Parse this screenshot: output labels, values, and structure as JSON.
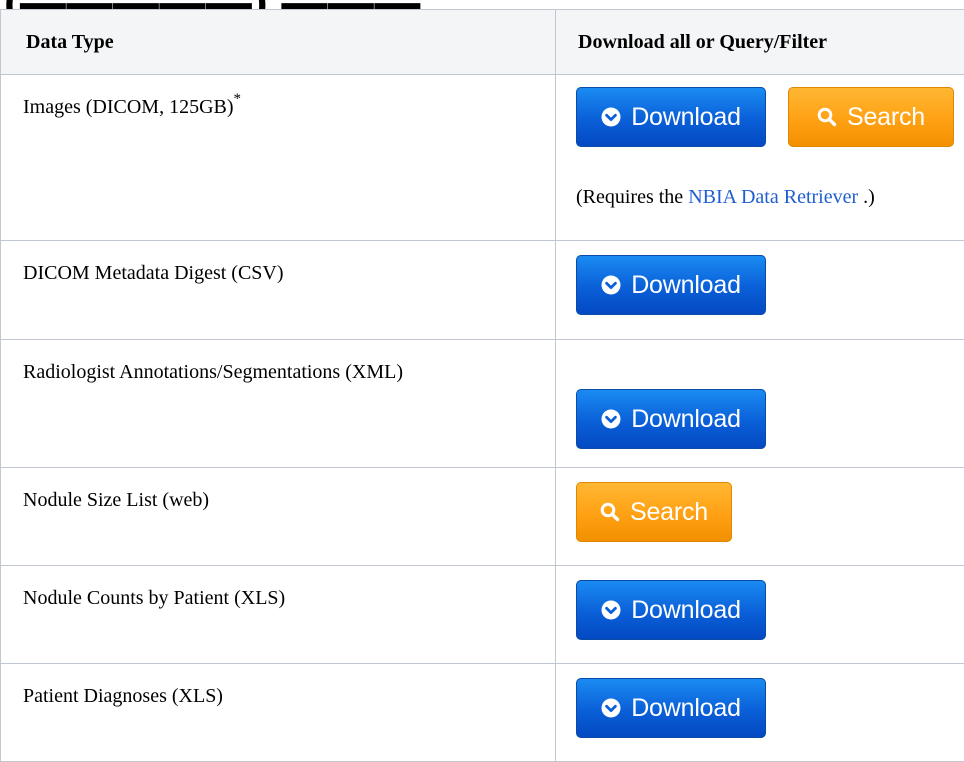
{
  "page": {
    "heading": "("
  },
  "table": {
    "headers": {
      "type": "Data Type",
      "action": "Download all or Query/Filter"
    },
    "rows": [
      {
        "type": "Images (DICOM, 125GB)",
        "footnote": "*"
      },
      {
        "type": "DICOM Metadata Digest (CSV)"
      },
      {
        "type": "Radiologist Annotations/Segmentations (XML)"
      },
      {
        "type": "Nodule Size List (web)"
      },
      {
        "type": "Nodule Counts by Patient (XLS)"
      },
      {
        "type": "Patient Diagnoses (XLS)"
      }
    ]
  },
  "buttons": {
    "download": "Download",
    "search": "Search"
  },
  "note": {
    "prefix": "(Requires the ",
    "link": "NBIA Data Retriever",
    "suffix": " .)"
  },
  "icons": {
    "download": "circle-chevron-down-icon",
    "search": "magnifier-icon"
  },
  "colors": {
    "download_button": "#0a5fd8",
    "search_button": "#ffa114",
    "link": "#1f5fd1",
    "header_background": "#f4f5f7",
    "border": "#c1c7d0"
  }
}
